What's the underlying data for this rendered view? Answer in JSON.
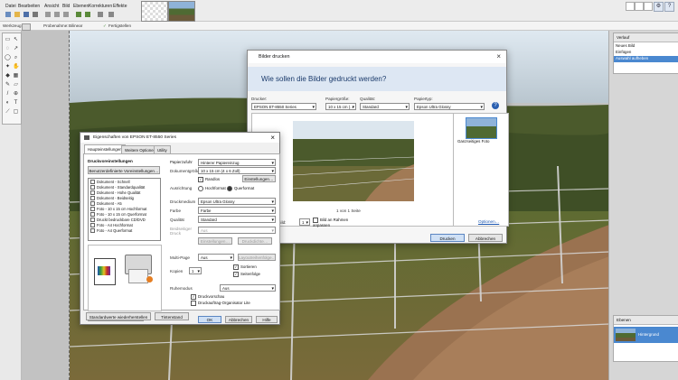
{
  "menubar": {
    "items": [
      "Datei",
      "Bearbeiten",
      "Ansicht",
      "Bild",
      "Ebenen",
      "Korrekturen",
      "Effekte"
    ]
  },
  "optionsbar": {
    "tool_label": "Werkzeug:",
    "mode_label": "Probenahme:",
    "mode_value": "Bilinear",
    "finish_label": "Fertigstellen"
  },
  "history_panel": {
    "title": "Verlauf",
    "items": [
      "Neues Bild",
      "Einfügen",
      "Auswahl aufheben",
      "Auswahl abschließen"
    ]
  },
  "layers_panel": {
    "title": "Ebenen",
    "layer_name": "Hintergrund"
  },
  "print_dialog": {
    "title": "Bilder drucken",
    "question": "Wie sollen die Bilder gedruckt werden?",
    "printer_label": "Drucker:",
    "printer_value": "EPSON ET-8550 Series",
    "paper_size_label": "Papiergröße:",
    "paper_size_value": "10 x 15 cm (…",
    "quality_label": "Qualität:",
    "quality_value": "Standard",
    "paper_type_label": "Papiertyp:",
    "paper_type_value": "Epson Ultra Glossy",
    "page_indicator": "1 von 1 Seite",
    "copies_label": "Kopien pro Bild:",
    "copies_value": "1",
    "fit_label": "Bild an Rahmen anpassen",
    "options_link": "Optionen…",
    "layout_name": "Ganzseitiges Foto",
    "print_button": "Drucken",
    "cancel_button": "Abbrechen"
  },
  "props_dialog": {
    "title": "Eigenschaften von EPSON ET-8550 Series",
    "tabs": [
      "Haupteinstellungen",
      "Weitere Optionen",
      "Utility"
    ],
    "presets_title": "Druckvoreinstellungen",
    "add_presets_button": "Benutzerdefinierte Voreinstellungen…",
    "presets": [
      "Dokument - Schnell",
      "Dokument - Standardqualität",
      "Dokument - Hohe Qualität",
      "Dokument - Beidseitig",
      "Dokument - A5",
      "Foto - 10 x 15 cm Hochformat",
      "Foto - 10 x 15 cm Querformat",
      "Druckt bedruckbare CD/DVD",
      "Foto - A4 Hochformat",
      "Foto - A4 Querformat"
    ],
    "paper_source_label": "Papierzufuhr",
    "paper_source_value": "Hinterer Papiereinzug",
    "doc_size_label": "Dokumentgröße",
    "doc_size_value": "10 x 15 cm (4 x 6 Zoll)",
    "borderless_label": "Randlos",
    "settings_button": "Einstellungen…",
    "orientation_label": "Ausrichtung",
    "portrait_label": "Hochformat",
    "landscape_label": "Querformat",
    "media_label": "Druckmedium",
    "media_value": "Epson Ultra Glossy",
    "color_label": "Farbe",
    "color_value": "Farbe",
    "quality_label": "Qualität",
    "quality_value": "Standard",
    "twosided_label": "Beidseitiger Druck",
    "twosided_value": "Aus",
    "twosided_settings_button": "Einstellungen…",
    "twosided_density_button": "Druckdichte…",
    "multipage_label": "Multi-Page",
    "multipage_value": "Aus",
    "page_order_button": "Layoutreihenfolge…",
    "copies_label": "Kopien",
    "copies_value": "1",
    "collate_label": "Sortieren",
    "reverse_label": "Seitenfolge",
    "quiet_label": "Ruhemodus",
    "quiet_value": "Aus",
    "preview_label": "Druckvorschau",
    "job_arranger_label": "Druckauftrag-Organisator Lite",
    "show_settings_button": "Einstellungen anzeigen",
    "restore_button": "Standardwerte wiederherstellen",
    "ink_button": "Tintenstand",
    "ok_button": "OK",
    "cancel_button": "Abbrechen",
    "help_button": "Hilfe"
  }
}
